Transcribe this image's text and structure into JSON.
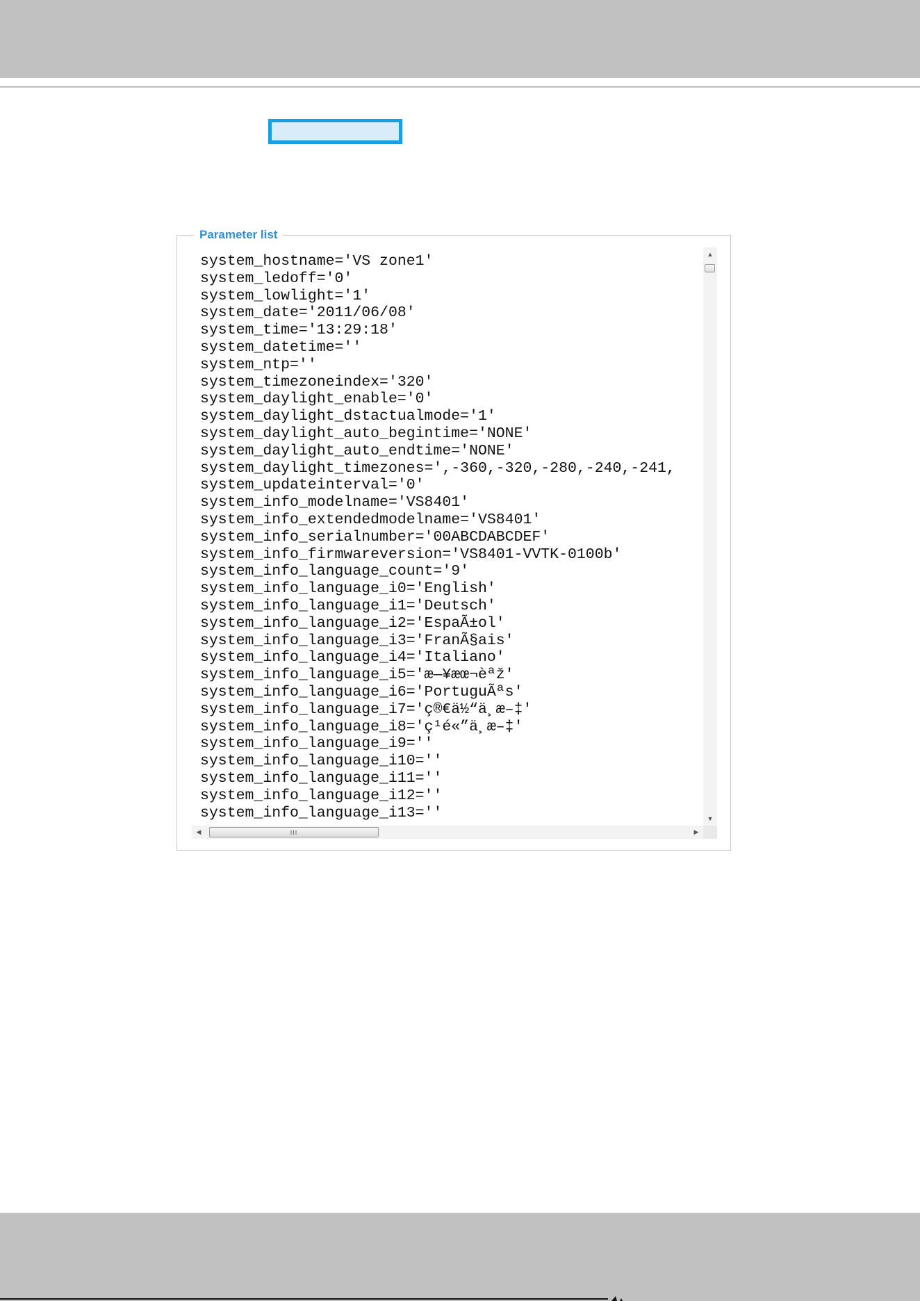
{
  "panel": {
    "legend": "Parameter list"
  },
  "parameters": {
    "lines": [
      "system_hostname='VS zone1'",
      "system_ledoff='0'",
      "system_lowlight='1'",
      "system_date='2011/06/08'",
      "system_time='13:29:18'",
      "system_datetime=''",
      "system_ntp=''",
      "system_timezoneindex='320'",
      "system_daylight_enable='0'",
      "system_daylight_dstactualmode='1'",
      "system_daylight_auto_begintime='NONE'",
      "system_daylight_auto_endtime='NONE'",
      "system_daylight_timezones=',-360,-320,-280,-240,-241,",
      "system_updateinterval='0'",
      "system_info_modelname='VS8401'",
      "system_info_extendedmodelname='VS8401'",
      "system_info_serialnumber='00ABCDABCDEF'",
      "system_info_firmwareversion='VS8401-VVTK-0100b'",
      "system_info_language_count='9'",
      "system_info_language_i0='English'",
      "system_info_language_i1='Deutsch'",
      "system_info_language_i2='EspaÃ±ol'",
      "system_info_language_i3='FranÃ§ais'",
      "system_info_language_i4='Italiano'",
      "system_info_language_i5='æ—¥æœ¬èªž'",
      "system_info_language_i6='PortuguÃªs'",
      "system_info_language_i7='ç®€ä½“ä¸­æ–‡'",
      "system_info_language_i8='ç¹é«”ä¸­æ–‡'",
      "system_info_language_i9=''",
      "system_info_language_i10=''",
      "system_info_language_i11=''",
      "system_info_language_i12=''",
      "system_info_language_i13=''"
    ]
  },
  "scrollbar": {
    "h_grip": "III"
  },
  "colors": {
    "accent_blue": "#1aa0e0",
    "legend_blue": "#2f8fd0",
    "band_gray": "#c0c1c0"
  }
}
